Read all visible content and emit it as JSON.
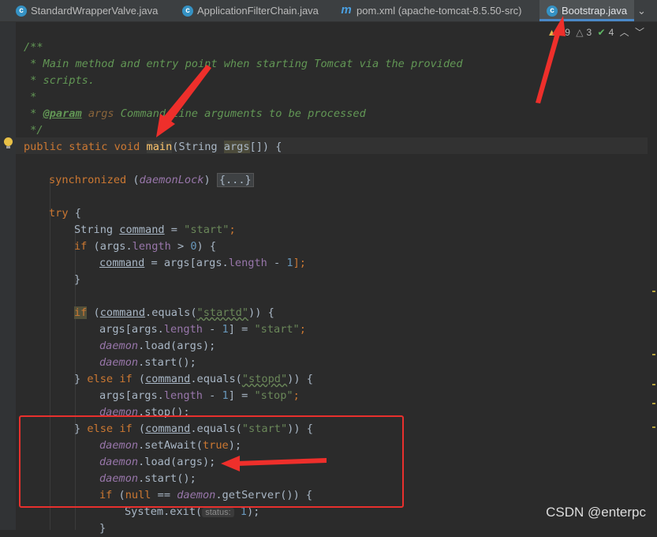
{
  "tabs": [
    {
      "label": "StandardWrapperValve.java",
      "icon": "java-class-icon",
      "active": false
    },
    {
      "label": "ApplicationFilterChain.java",
      "icon": "java-class-icon",
      "active": false
    },
    {
      "label": "pom.xml (apache-tomcat-8.5.50-src)",
      "icon": "maven-icon",
      "active": false
    },
    {
      "label": "Bootstrap.java",
      "icon": "java-class-icon",
      "active": true
    }
  ],
  "inspections": {
    "warnings": "19",
    "weak_warnings": "3",
    "typos": "4"
  },
  "code": {
    "l1": "/**",
    "l2": " * Main method and entry point when starting Tomcat via the provided",
    "l3": " * scripts.",
    "l4": " *",
    "l5_star": " * ",
    "l5_tag": "@param",
    "l5_name": " args",
    "l5_text": " Command line arguments to be processed",
    "l6": " */",
    "sig": {
      "public": "public",
      "static": "static",
      "void": "void",
      "main": "main",
      "paren": "(String ",
      "args": "args",
      "tail": "[]) {"
    },
    "sync": {
      "kw": "synchronized",
      "open": " (",
      "lock": "daemonLock",
      "close": ") ",
      "fold": "{...}"
    },
    "try": {
      "kw": "try",
      "rest": " {"
    },
    "cmd_decl": {
      "type": "String ",
      "var": "command",
      "eq": " = ",
      "val": "\"start\"",
      "end": ";"
    },
    "if_len": {
      "kw": "if",
      "a": " (args.",
      "f": "length",
      "b": " > ",
      "n": "0",
      "c": ") {"
    },
    "cmd_assign": {
      "var": "command",
      "a": " = args[args.",
      "f": "length",
      "b": " - ",
      "n": "1",
      "c": "];"
    },
    "close1": "}",
    "if_startd": {
      "kw": "if",
      "a": " (",
      "var": "command",
      "b": ".equals(",
      "s": "\"startd\"",
      "c": ")) {"
    },
    "args0_set": {
      "a": "args[args.",
      "f": "length",
      "b": " - ",
      "n": "1",
      "c": "] = ",
      "s": "\"start\"",
      "d": ";"
    },
    "daemon_load1": {
      "d": "daemon",
      "rest": ".load(args);"
    },
    "daemon_start1": {
      "d": "daemon",
      "rest": ".start();"
    },
    "elif_stopd": {
      "a": "} ",
      "kw1": "else",
      "sp": " ",
      "kw2": "if",
      "b": " (",
      "var": "command",
      "c": ".equals(",
      "s": "\"stopd\"",
      "d": ")) {"
    },
    "args0_stop": {
      "a": "args[args.",
      "f": "length",
      "b": " - ",
      "n": "1",
      "c": "] = ",
      "s": "\"stop\"",
      "d": ";"
    },
    "daemon_stop": {
      "d": "daemon",
      "rest": ".stop();"
    },
    "elif_start": {
      "a": "} ",
      "kw1": "else",
      "sp": " ",
      "kw2": "if",
      "b": " (",
      "var": "command",
      "c": ".equals(",
      "s": "\"start\"",
      "d": ")) {"
    },
    "set_await": {
      "d": "daemon",
      "a": ".setAwait(",
      "kw": "true",
      "b": ");"
    },
    "daemon_load2": {
      "d": "daemon",
      "rest": ".load(args);"
    },
    "daemon_start2": {
      "d": "daemon",
      "rest": ".start();"
    },
    "if_null": {
      "kw": "if",
      "a": " (",
      "kw2": "null",
      "b": " == ",
      "d": "daemon",
      "c": ".getServer()) {"
    },
    "sys_exit": {
      "a": "System.",
      "b": "exit(",
      "hint": "status:",
      "n": " 1",
      "c": ");"
    },
    "close2": "}"
  },
  "watermark": "CSDN @enterpc"
}
